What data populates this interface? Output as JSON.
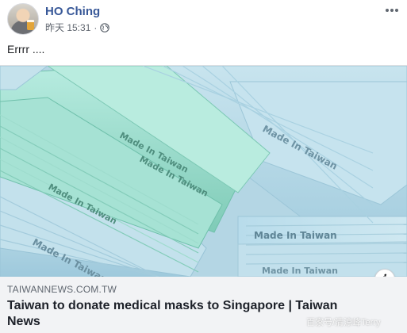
{
  "post": {
    "author_name": "HO Ching",
    "time": "昨天 15:31",
    "meta_separator": "·",
    "privacy_icon": "globe-icon",
    "more_icon": "more-options-icon",
    "text": "Errrr ...."
  },
  "link_preview": {
    "image_subject": "stacked blue and green surgical masks",
    "mask_imprint": "Made In Taiwan",
    "domain": "TAIWANNEWS.COM.TW",
    "title": "Taiwan to donate medical masks to Singapore | Taiwan News",
    "info_icon": "info-icon",
    "info_label": "i"
  },
  "watermark": "百家号/清涼峰Terry",
  "colors": {
    "author_link": "#385898",
    "meta_text": "#616770",
    "card_background": "#f2f3f5",
    "mask_blue": "#a9d1e2",
    "mask_green": "#8fd5c4"
  }
}
